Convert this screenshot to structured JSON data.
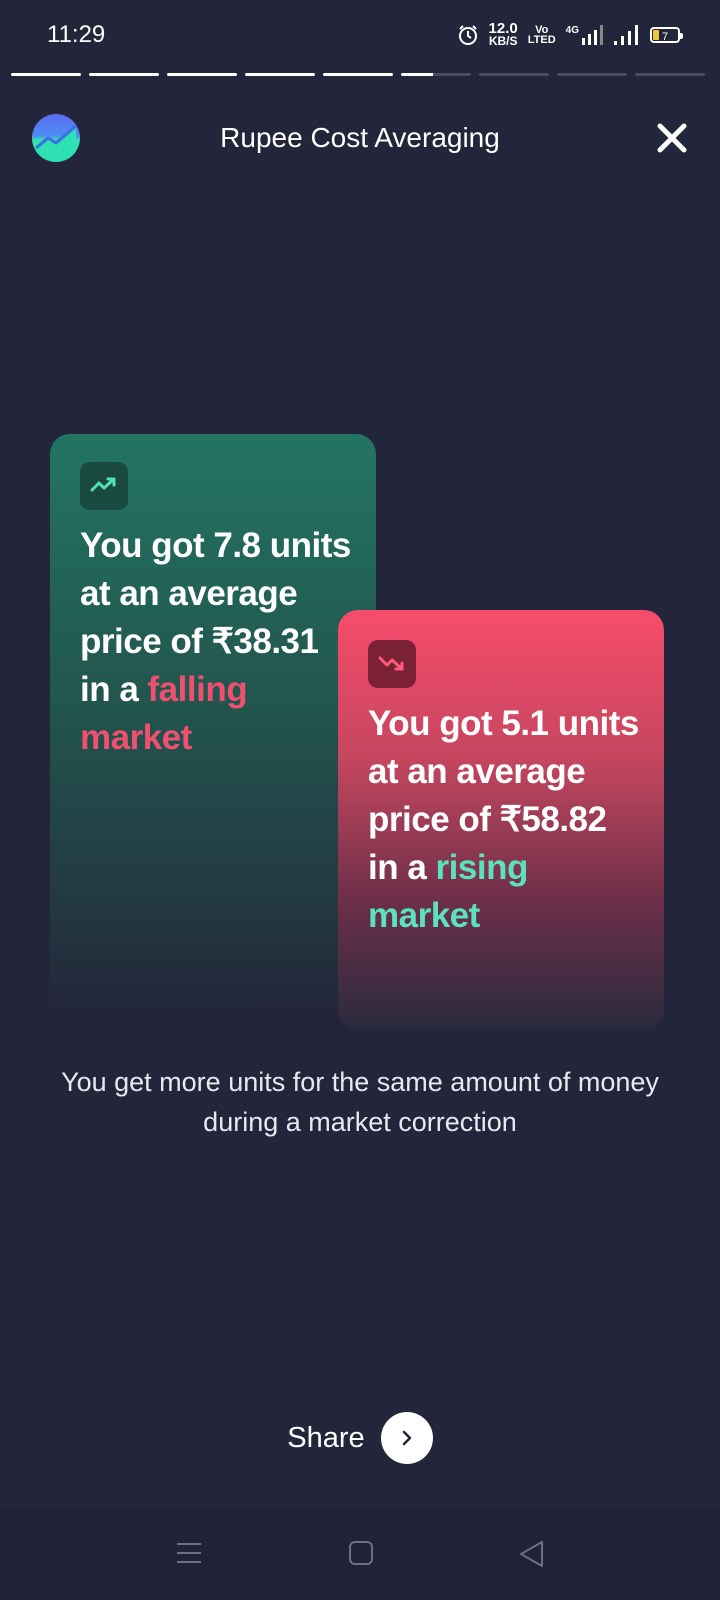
{
  "status_bar": {
    "time": "11:29",
    "speed_value": "12.0",
    "speed_unit": "KB/S",
    "volte_top": "Vo",
    "volte_bottom": "LTED",
    "network": "4G",
    "battery": "7"
  },
  "story_progress": {
    "segments": 9,
    "completed": 5,
    "current_fill": 0.45
  },
  "header": {
    "title": "Rupee Cost Averaging",
    "logo_icon": "chart-logo-icon",
    "close_icon": "close-icon"
  },
  "cards": {
    "falling": {
      "icon": "trend-up-icon",
      "text": "You got 7.8 units at an average price of ₹38.31 in a",
      "highlight": "falling market",
      "highlight_color": "#f05070"
    },
    "rising": {
      "icon": "trend-down-icon",
      "text": "You got 5.1 units at an average price of ₹58.82 in a",
      "highlight": "rising market",
      "highlight_color": "#5be2bd"
    }
  },
  "caption": "You get more units for the same amount of money during a market correction",
  "share": {
    "label": "Share",
    "icon": "chevron-right-icon"
  },
  "nav_bar": {
    "icons": [
      "menu-icon",
      "home-square-icon",
      "back-triangle-icon"
    ]
  },
  "colors": {
    "background": "#23253a",
    "green_card": "#237463",
    "red_card": "#f64c6b"
  }
}
